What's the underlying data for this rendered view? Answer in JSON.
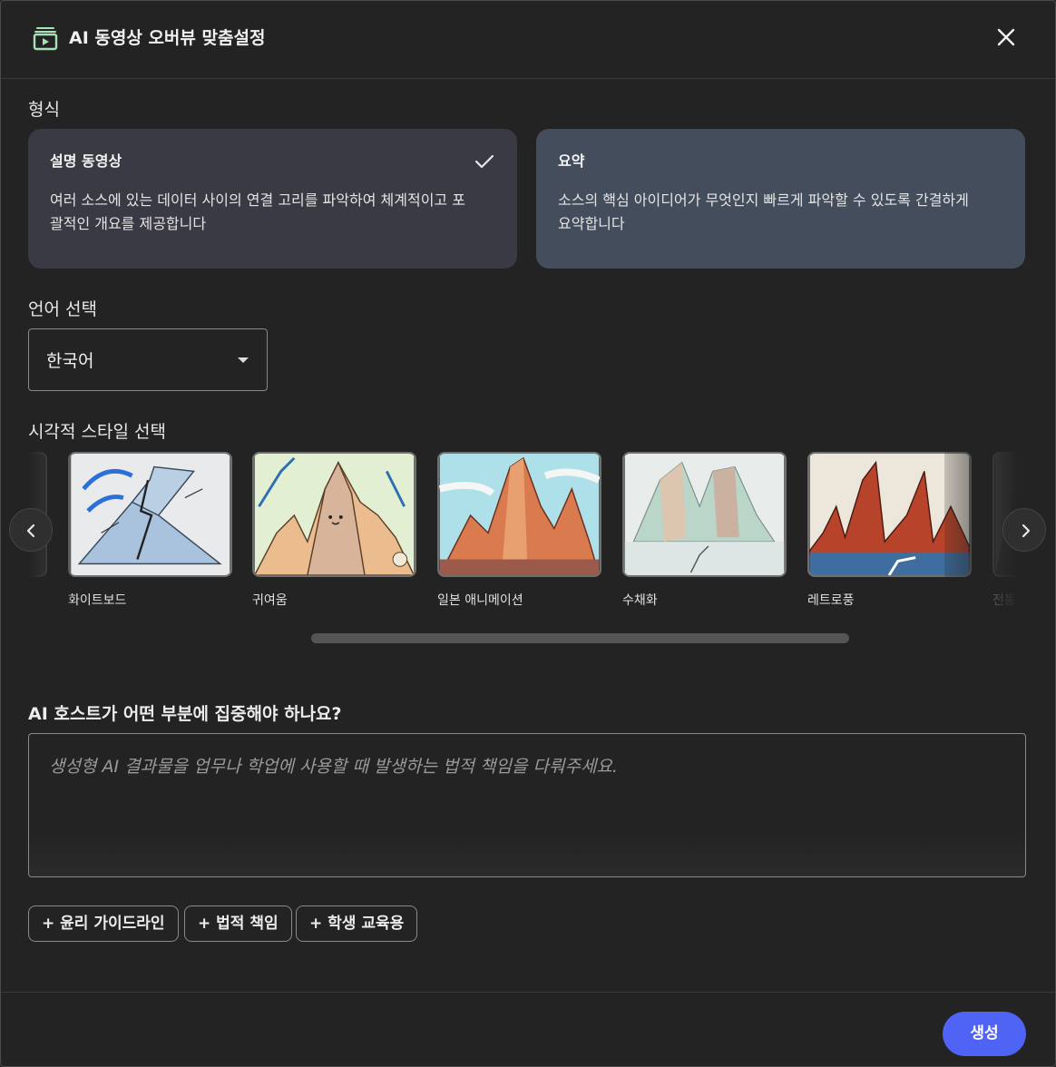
{
  "dialog": {
    "title": "AI 동영상 오버뷰 맞춤설정",
    "icon": "video-overview-icon",
    "close_icon": "close-icon"
  },
  "format": {
    "label": "형식",
    "options": [
      {
        "title": "설명 동영상",
        "desc_line1": "여러 소스에 있는 데이터 사이의 연결 고리를 파악하여 체계적이고 포",
        "desc_line2": "괄적인 개요를 제공합니다",
        "selected": true
      },
      {
        "title": "요약",
        "desc_line1": "소스의 핵심 아이디어가 무엇인지 빠르게 파악할 수 있도록 간결하게",
        "desc_line2": "요약합니다",
        "selected": false
      }
    ]
  },
  "language": {
    "label": "언어 선택",
    "value": "한국어"
  },
  "style": {
    "label": "시각적 스타일 선택",
    "items": [
      {
        "label": "화이트보드"
      },
      {
        "label": "귀여움"
      },
      {
        "label": "일본 애니메이션"
      },
      {
        "label": "수채화"
      },
      {
        "label": "레트로풍"
      },
      {
        "label": "전통"
      }
    ]
  },
  "focus": {
    "label": "AI 호스트가 어떤 부분에 집중해야 하나요?",
    "placeholder": "생성형 AI 결과물을 업무나 학업에 사용할 때 발생하는 법적 책임을 다뤄주세요."
  },
  "chips": [
    "+ 윤리 가이드라인",
    "+ 법적 책임",
    "+ 학생 교육용"
  ],
  "actions": {
    "generate": "생성"
  },
  "colors": {
    "background": "#232323",
    "selected_card": "#3a3a44",
    "other_card": "#444d5b",
    "primary_button": "#4f63f4"
  }
}
